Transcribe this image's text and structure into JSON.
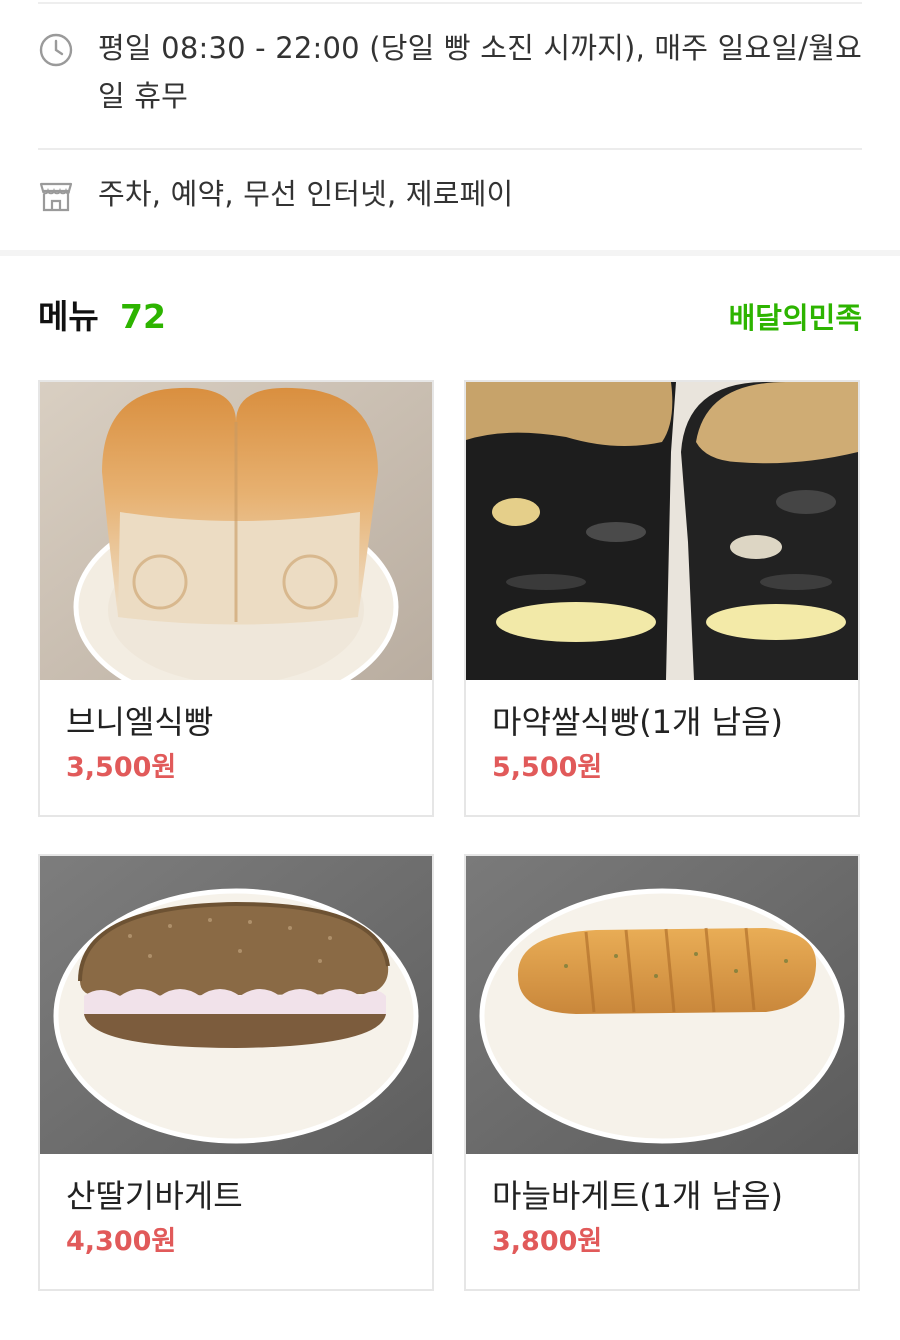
{
  "store_info": {
    "hours_text": "평일 08:30 - 22:00 (당일 빵 소진 시까지), 매주 일요일/월요일 휴무",
    "hours_icon": "clock-icon",
    "amenities_text": "주차, 예약, 무선 인터넷, 제로페이",
    "amenities_icon": "store-icon"
  },
  "menu": {
    "title": "메뉴",
    "count": "72",
    "delivery_link": "배달의민족",
    "items": [
      {
        "name": "브니엘식빵",
        "price": "3,500원",
        "image": "white-bread-loaf"
      },
      {
        "name": "마약쌀식빵(1개 남음)",
        "price": "5,500원",
        "image": "black-sesame-rice-bread"
      },
      {
        "name": "산딸기바게트",
        "price": "4,300원",
        "image": "raspberry-cream-baguette"
      },
      {
        "name": "마늘바게트(1개 남음)",
        "price": "3,800원",
        "image": "garlic-baguette"
      }
    ]
  },
  "colors": {
    "accent_green": "#2db400",
    "price_red": "#e15a5a",
    "text_dark": "#222222",
    "icon_gray": "#9a9a9a"
  }
}
